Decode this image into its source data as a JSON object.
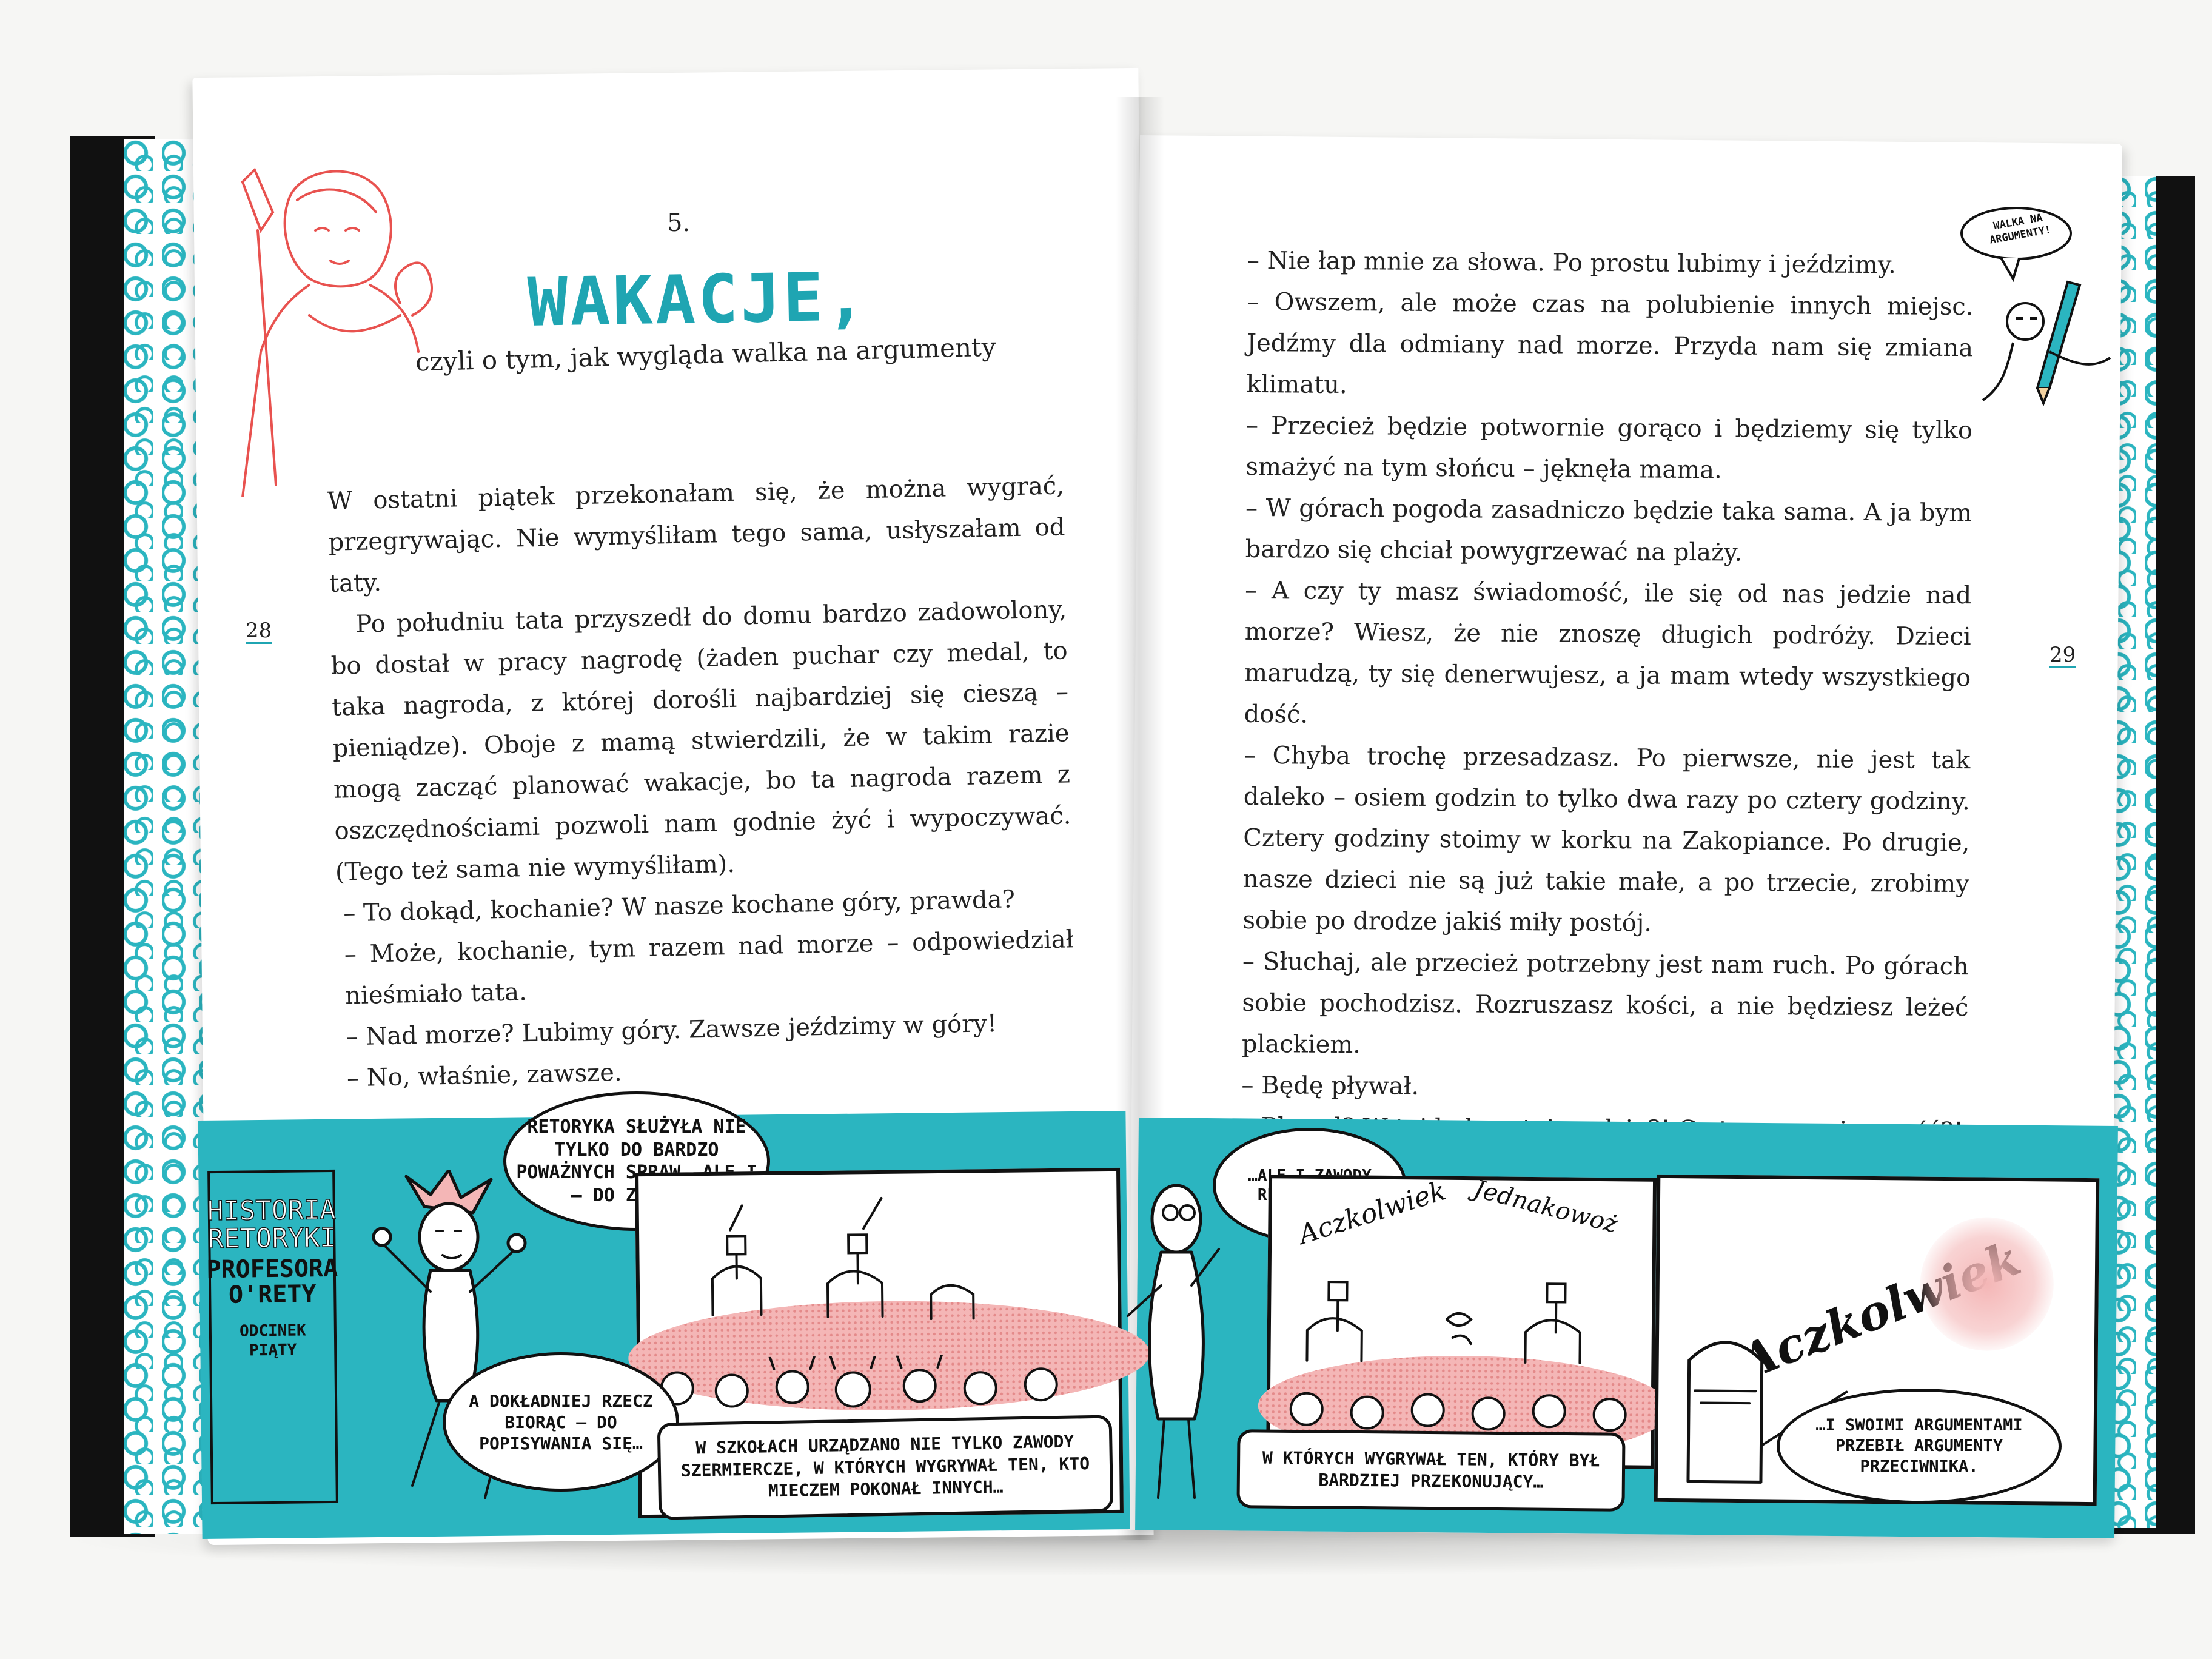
{
  "left_page": {
    "chapter_number": "5.",
    "chapter_title": "WAKACJE,",
    "chapter_subtitle": "czyli o tym, jak wygląda walka na argumenty",
    "page_number": "28",
    "paragraphs": [
      "W ostatni piątek przekonałam się, że można wygrać, przegrywając. Nie wymyśliłam tego sama, usłyszałam od taty.",
      "Po południu tata przyszedł do domu bardzo zadowolony, bo dostał w pracy nagrodę (żaden puchar czy medal, to taka nagroda, z której dorośli najbardziej się cieszą – pieniądze). Oboje z mamą stwierdzili, że w takim razie mogą zacząć planować wakacje, bo ta nagroda razem z oszczędnościami pozwoli nam godnie żyć i wypoczywać. (Tego też sama nie wymyśliłam).",
      "– To dokąd, kochanie? W nasze kochane góry, prawda?",
      "– Może, kochanie, tym razem nad morze – odpowiedział nieśmiało tata.",
      "– Nad morze? Lubimy góry. Zawsze jeździmy w góry!",
      "– No, właśnie, zawsze."
    ]
  },
  "right_page": {
    "page_number": "29",
    "note_bubble": "WALKA NA ARGUMENTY!",
    "paragraphs": [
      "– Nie łap mnie za słowa. Po prostu lubimy i jeździmy.",
      "– Owszem, ale może czas na polubienie innych miejsc. Jedźmy dla odmiany nad morze. Przyda nam się zmiana klimatu.",
      "– Przecież będzie potwornie gorąco i będziemy się tylko smażyć na tym słońcu – jęknęła mama.",
      "– W górach pogoda zasadniczo będzie taka sama. A ja bym bardzo się chciał powygrzewać na plaży.",
      "– A czy ty masz świadomość, ile się od nas jedzie nad morze? Wiesz, że nie znoszę długich podróży. Dzieci marudzą, ty się denerwujesz, a ja mam wtedy wszystkiego dość.",
      "– Chyba trochę przesadzasz. Po pierwsze, nie jest tak daleko – osiem godzin to tylko dwa razy po cztery godziny. Cztery godziny stoimy w korku na Zakopiance. Po drugie, nasze dzieci nie są już takie małe, a po trzecie, zrobimy sobie po drodze jakiś miły postój.",
      "– Słuchaj, ale przecież potrzebny jest nam ruch. Po górach sobie pochodzisz. Rozruszasz kości, a nie będziesz leżeć plackiem.",
      "– Będę pływał.",
      "– Pływał? W tej lodowatej wodzie?! Co to za przyjemność?!"
    ]
  },
  "comic": {
    "plaque": {
      "title": "HISTORIA RETORYKI",
      "author": "PROFESORA O'RETY",
      "episode": "ODCINEK PIĄTY"
    },
    "bubble_1": "RETORYKA SŁUŻYŁA NIE TYLKO DO BARDZO POWAŻNYCH SPRAW, ALE I – DO ZABAWY.",
    "bubble_2": "A DOKŁADNIEJ RZECZ BIORĄC – DO POPISYWANIA SIĘ…",
    "caption_1": "W SZKOŁACH URZĄDZANO NIE TYLKO ZAWODY SZERMIERCZE, W KTÓRYCH WYGRYWAŁ TEN, KTO MIECZEM POKONAŁ INNYCH…",
    "bubble_3": "…ALE I ZAWODY RETORYCZNE,",
    "caption_2": "W KTÓRYCH WYGRYWAŁ TEN, KTÓRY BYŁ BARDZIEJ PRZEKONUJĄCY…",
    "bubble_4": "…I SWOIMI ARGUMENTAMI PRZEBIŁ ARGUMENTY PRZECIWNIKA.",
    "calligraphy_1": "Aczkolwiek",
    "calligraphy_2": "Jednakowoż",
    "calligraphy_3": "Aczkolwiek"
  },
  "colors": {
    "teal": "#2bb5c0",
    "title_teal": "#1fa5b2",
    "pink": "#f4b6b6",
    "sketch_red": "#e8524f"
  }
}
